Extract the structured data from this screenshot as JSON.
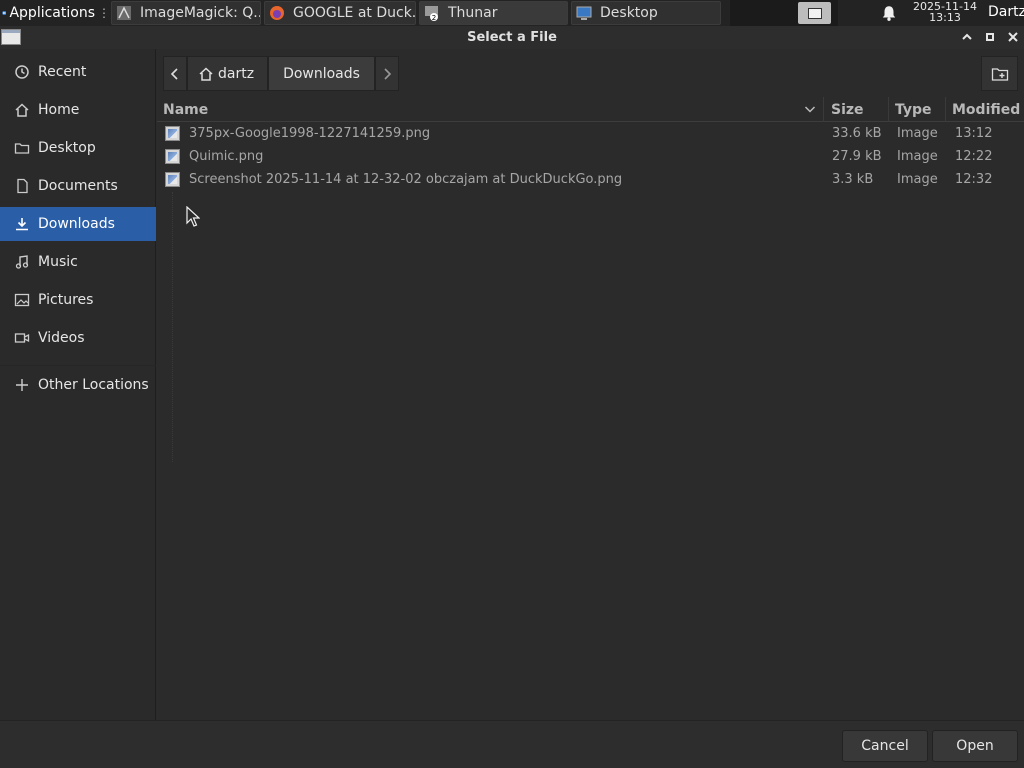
{
  "panel": {
    "applications_label": "Applications",
    "tasks": [
      {
        "label": "ImageMagick: Q...",
        "icon": "imagemagick-icon"
      },
      {
        "label": "GOOGLE at Duck...",
        "icon": "firefox-icon"
      },
      {
        "label": "Thunar",
        "icon": "thunar-icon",
        "badge": "2"
      },
      {
        "label": "Desktop",
        "icon": "desktop-icon"
      }
    ],
    "clock_date": "2025-11-14",
    "clock_time": "13:13",
    "user": "Dartz"
  },
  "dialog": {
    "title": "Select a File"
  },
  "sidebar": {
    "items": [
      {
        "label": "Recent",
        "icon": "recent-icon"
      },
      {
        "label": "Home",
        "icon": "home-icon"
      },
      {
        "label": "Desktop",
        "icon": "desktop-folder-icon"
      },
      {
        "label": "Documents",
        "icon": "documents-icon"
      },
      {
        "label": "Downloads",
        "icon": "downloads-icon",
        "active": true
      },
      {
        "label": "Music",
        "icon": "music-icon"
      },
      {
        "label": "Pictures",
        "icon": "pictures-icon"
      },
      {
        "label": "Videos",
        "icon": "videos-icon"
      },
      {
        "label": "Other Locations",
        "icon": "plus-icon"
      }
    ]
  },
  "pathbar": {
    "home_crumb": "dartz",
    "current_crumb": "Downloads"
  },
  "columns": {
    "name": "Name",
    "size": "Size",
    "type": "Type",
    "modified": "Modified"
  },
  "files": [
    {
      "name": "375px-Google1998-1227141259.png",
      "size": "33.6 kB",
      "type": "Image",
      "modified": "13:12"
    },
    {
      "name": "Quimic.png",
      "size": "27.9 kB",
      "type": "Image",
      "modified": "12:22"
    },
    {
      "name": "Screenshot 2025-11-14 at 12-32-02 obczajam at DuckDuckGo.png",
      "size": "3.3 kB",
      "type": "Image",
      "modified": "12:32"
    }
  ],
  "footer": {
    "cancel_label": "Cancel",
    "open_label": "Open"
  },
  "colors": {
    "accent": "#2a5fa8",
    "background": "#2b2b2b"
  }
}
